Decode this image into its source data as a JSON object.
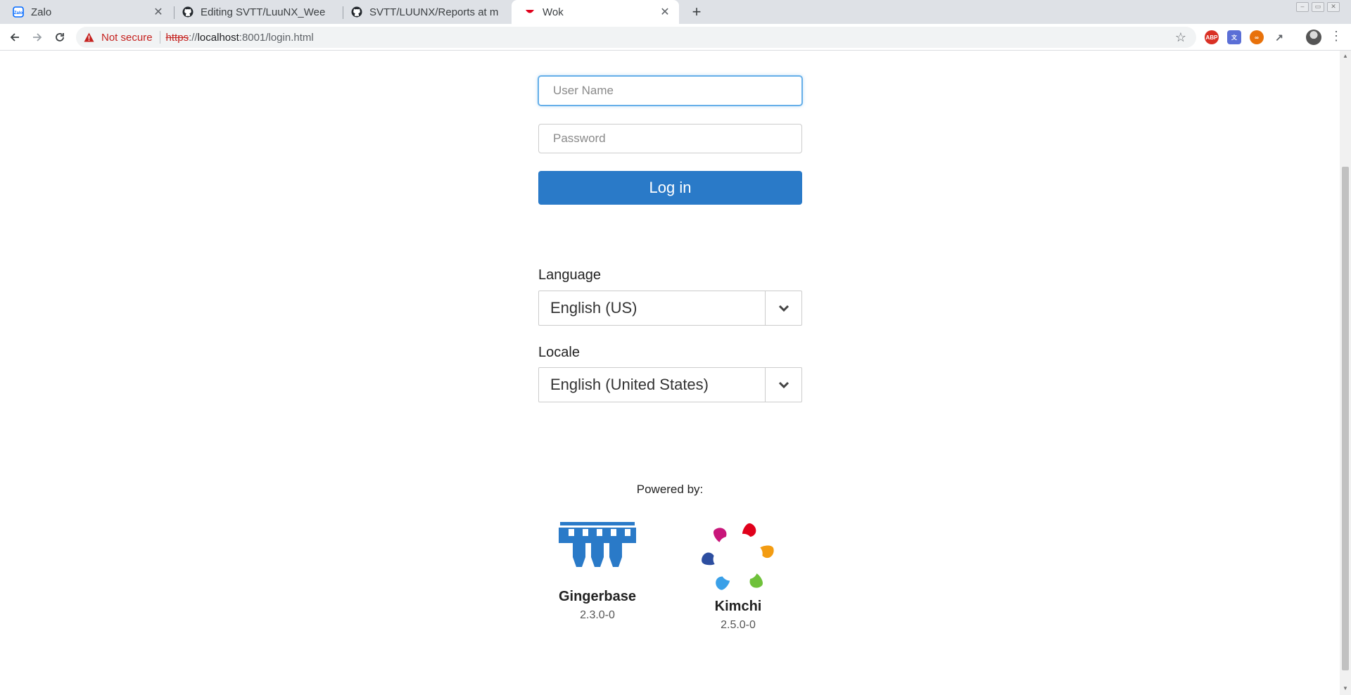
{
  "browser": {
    "tabs": [
      {
        "title": "Zalo"
      },
      {
        "title": "Editing SVTT/LuuNX_Wee"
      },
      {
        "title": "SVTT/LUUNX/Reports at m"
      },
      {
        "title": "Wok"
      }
    ],
    "security_label": "Not secure",
    "url": {
      "scheme": "https",
      "separator": "://",
      "host": "localhost",
      "rest": ":8001/login.html"
    },
    "extensions": [
      "ABP",
      "translate-icon",
      "infinity-icon",
      "cursor-icon"
    ]
  },
  "login": {
    "username_placeholder": "User Name",
    "password_placeholder": "Password",
    "login_label": "Log in"
  },
  "language": {
    "label": "Language",
    "selected": "English (US)"
  },
  "locale": {
    "label": "Locale",
    "selected": "English (United States)"
  },
  "footer": {
    "powered_by": "Powered by:",
    "plugins": [
      {
        "name": "Gingerbase",
        "version": "2.3.0-0"
      },
      {
        "name": "Kimchi",
        "version": "2.5.0-0"
      }
    ]
  },
  "colors": {
    "primary_button": "#2a7ac8",
    "gingerbase_logo": "#2a7ac8",
    "not_secure": "#c5221f"
  }
}
